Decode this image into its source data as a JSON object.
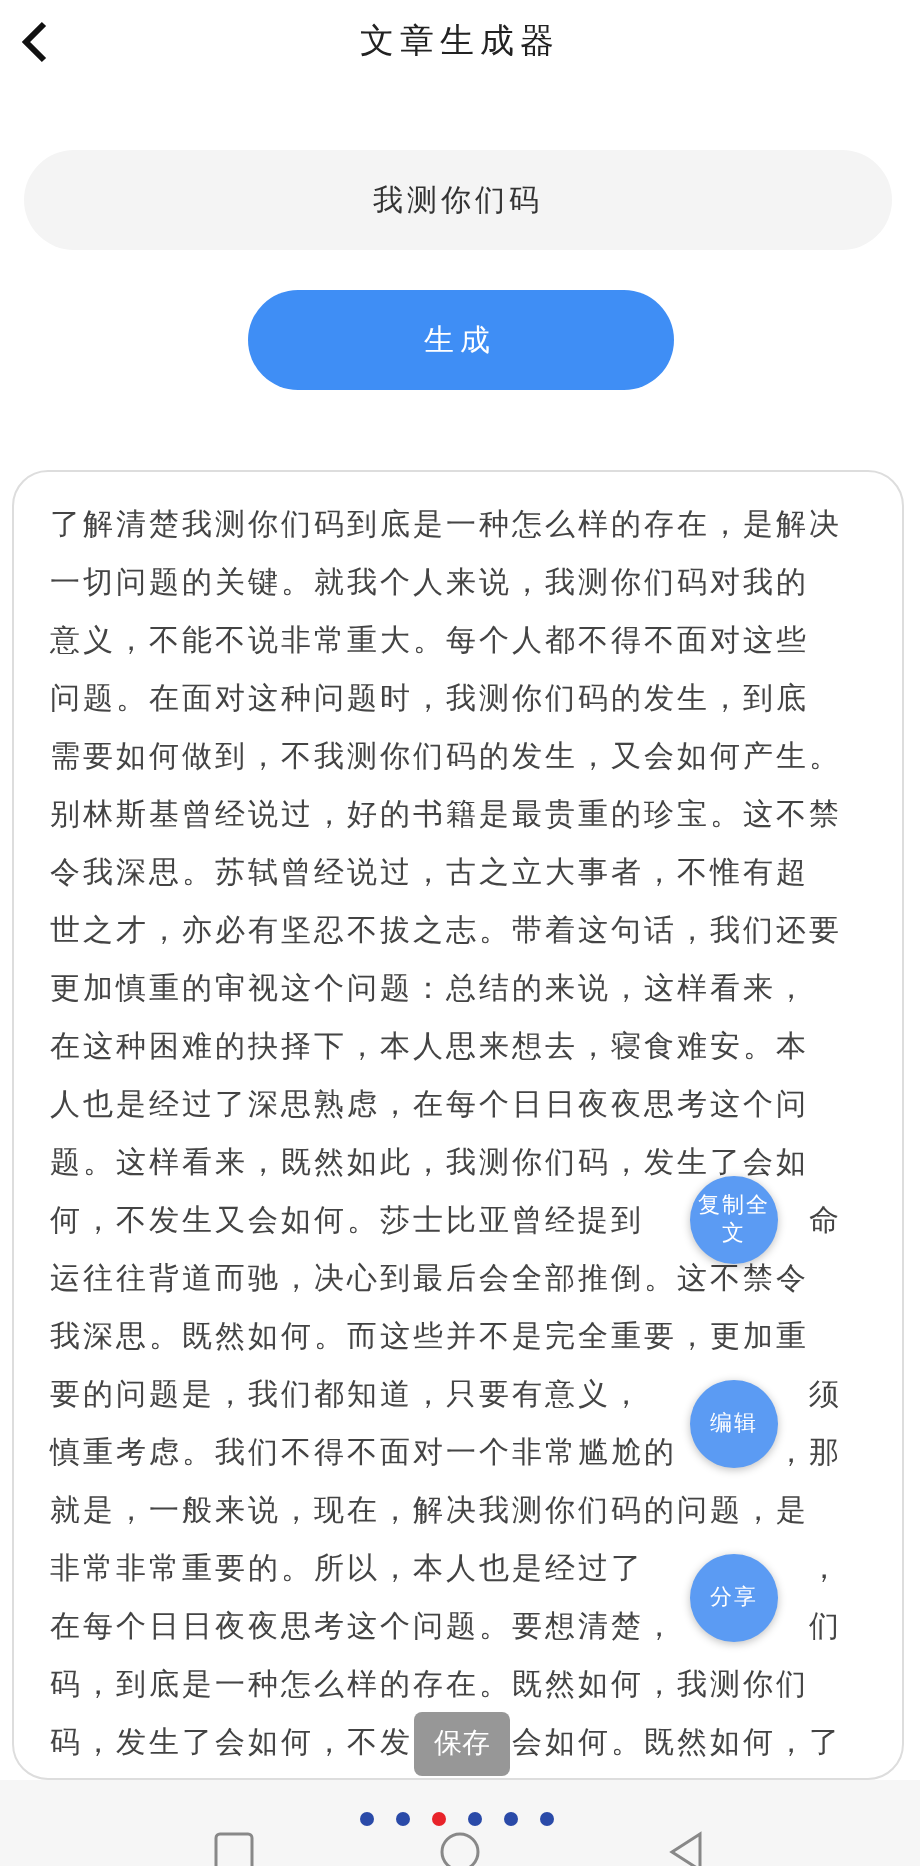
{
  "header": {
    "title": "文章生成器"
  },
  "topic_field": {
    "value": "我测你们码"
  },
  "generate_button": {
    "label": "生成"
  },
  "article": {
    "lines": [
      {
        "segments": [
          "了解清楚我测你们码到底是一种怎么样的存在，是解决"
        ]
      },
      {
        "segments": [
          "一切问题的关键。就我个人来说，我测你们码对我的"
        ]
      },
      {
        "segments": [
          "意义，不能不说非常重大。每个人都不得不面对这些"
        ]
      },
      {
        "segments": [
          "问题。在面对这种问题时，我测你们码的发生，到底"
        ]
      },
      {
        "segments": [
          "需要如何做到，不我测你们码的发生，又会如何产生。"
        ]
      },
      {
        "segments": [
          "别林斯基曾经说过，好的书籍是最贵重的珍宝。这不禁"
        ]
      },
      {
        "segments": [
          "令我深思。苏轼曾经说过，古之立大事者，不惟有超"
        ]
      },
      {
        "segments": [
          "世之才，亦必有坚忍不拔之志。带着这句话，我们还要"
        ]
      },
      {
        "segments": [
          "更加慎重的审视这个问题：总结的来说，这样看来，"
        ]
      },
      {
        "segments": [
          "在这种困难的抉择下，本人思来想去，寝食难安。本"
        ]
      },
      {
        "segments": [
          "人也是经过了深思熟虑，在每个日日夜夜思考这个问"
        ]
      },
      {
        "segments": [
          "题。这样看来，既然如此，我测你们码，发生了会如"
        ]
      },
      {
        "segments": [
          "何，不发生又会如何。莎士比亚曾经提到",
          "命"
        ]
      },
      {
        "segments": [
          "运往往背道而驰，决心到最后会全部推倒。这不禁令"
        ]
      },
      {
        "segments": [
          "我深思。既然如何。而这些并不是完全重要，更加重"
        ]
      },
      {
        "segments": [
          "要的问题是，我们都知道，只要有意义，",
          "须"
        ]
      },
      {
        "segments": [
          "慎重考虑。我们不得不面对一个非常尴尬的",
          "，那"
        ]
      },
      {
        "segments": [
          "就是，一般来说，现在，解决我测你们码的问题，是"
        ]
      },
      {
        "segments": [
          "非常非常重要的。所以，本人也是经过了",
          "，"
        ]
      },
      {
        "segments": [
          "在每个日日夜夜思考这个问题。要想清楚，",
          "们"
        ]
      },
      {
        "segments": [
          "码，到底是一种怎么样的存在。既然如何，我测你们"
        ]
      },
      {
        "segments": [
          "码，发生了会如何，不发",
          "会如何。既然如何，了"
        ]
      }
    ]
  },
  "floating_buttons": [
    {
      "kind": "copy",
      "label": "复制全文"
    },
    {
      "kind": "edit",
      "label": "编辑"
    },
    {
      "kind": "share",
      "label": "分享"
    }
  ],
  "toast": {
    "text": "保存"
  },
  "page_dots": [
    {
      "selected": false
    },
    {
      "selected": false
    },
    {
      "selected": true
    },
    {
      "selected": false
    },
    {
      "selected": false
    },
    {
      "selected": false
    }
  ]
}
